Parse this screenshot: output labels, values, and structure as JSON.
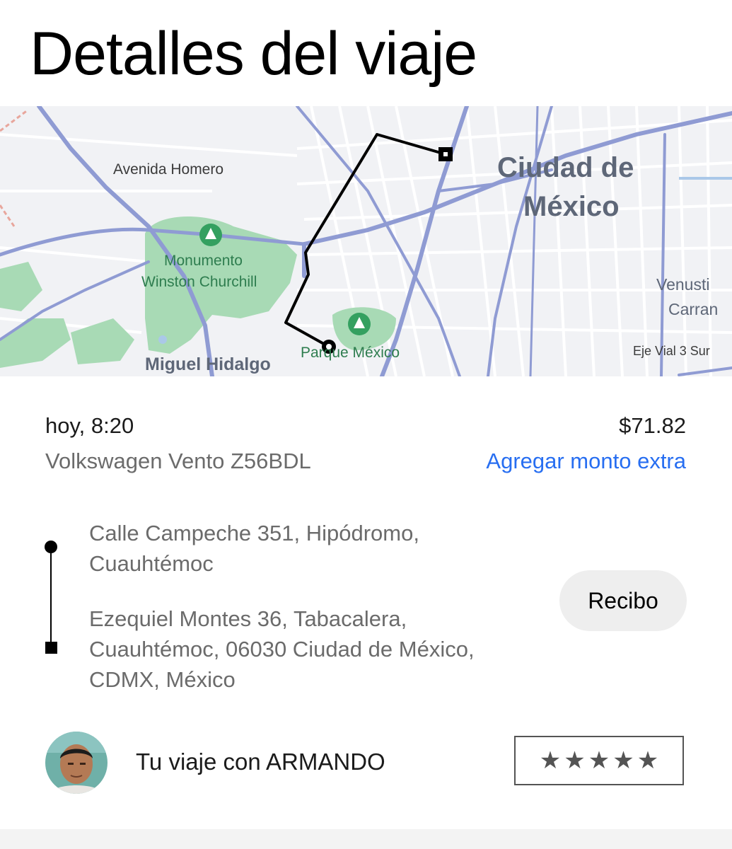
{
  "header": {
    "title": "Detalles del viaje"
  },
  "map": {
    "labels": {
      "avenida_homero": "Avenida Homero",
      "city_line1": "Ciudad de",
      "city_line2": "México",
      "monumento_line1": "Monumento",
      "monumento_line2": "Winston Churchill",
      "venustiano_line1": "Venusti",
      "venustiano_line2": "Carran",
      "parque_mexico": "Parque México",
      "eje_vial": "Eje Vial 3 Sur",
      "miguel_hidalgo": "Miguel Hidalgo"
    },
    "colors": {
      "route": "#000000",
      "park": "#a8dab5",
      "major_road": "#8f9bd3",
      "water": "#aac8e8"
    }
  },
  "trip": {
    "date_time": "hoy, 8:20",
    "vehicle": "Volkswagen Vento Z56BDL",
    "fare": "$71.82",
    "tip_link": "Agregar monto extra"
  },
  "route": {
    "pickup": "Calle Campeche 351, Hipódromo, Cuauhtémoc",
    "dropoff": "Ezequiel Montes 36, Tabacalera, Cuauhtémoc, 06030 Ciudad de México, CDMX, México"
  },
  "actions": {
    "receipt_label": "Recibo"
  },
  "driver": {
    "text": "Tu viaje con ARMANDO",
    "rating_max": 5,
    "rating_selected": 0,
    "star_glyph": "★",
    "star_color": "#545454"
  }
}
